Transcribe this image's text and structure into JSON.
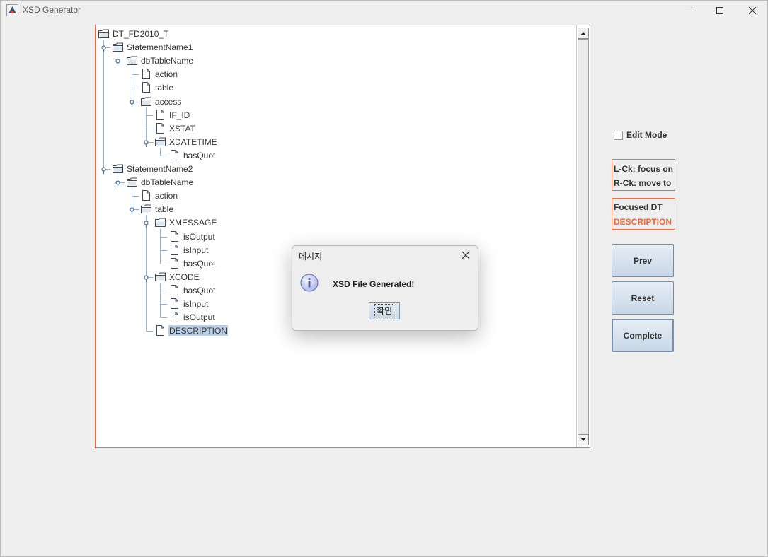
{
  "window": {
    "title": "XSD Generator"
  },
  "tree": [
    {
      "label": "DT_FD2010_T",
      "type": "folder",
      "depth": 0,
      "toggle": false,
      "selected": false
    },
    {
      "label": "StatementName1",
      "type": "folder",
      "depth": 1,
      "toggle": true,
      "selected": false
    },
    {
      "label": "dbTableName",
      "type": "folder",
      "depth": 2,
      "toggle": true,
      "selected": false
    },
    {
      "label": "action",
      "type": "file",
      "depth": 3,
      "toggle": false,
      "selected": false
    },
    {
      "label": "table",
      "type": "file",
      "depth": 3,
      "toggle": false,
      "selected": false
    },
    {
      "label": "access",
      "type": "folder",
      "depth": 3,
      "toggle": true,
      "selected": false
    },
    {
      "label": "IF_ID",
      "type": "file",
      "depth": 4,
      "toggle": false,
      "selected": false
    },
    {
      "label": "XSTAT",
      "type": "file",
      "depth": 4,
      "toggle": false,
      "selected": false
    },
    {
      "label": "XDATETIME",
      "type": "folder",
      "depth": 4,
      "toggle": true,
      "selected": false
    },
    {
      "label": "hasQuot",
      "type": "file",
      "depth": 5,
      "toggle": false,
      "selected": false
    },
    {
      "label": "StatementName2",
      "type": "folder",
      "depth": 1,
      "toggle": true,
      "selected": false
    },
    {
      "label": "dbTableName",
      "type": "folder",
      "depth": 2,
      "toggle": true,
      "selected": false
    },
    {
      "label": "action",
      "type": "file",
      "depth": 3,
      "toggle": false,
      "selected": false
    },
    {
      "label": "table",
      "type": "folder",
      "depth": 3,
      "toggle": true,
      "selected": false
    },
    {
      "label": "XMESSAGE",
      "type": "folder",
      "depth": 4,
      "toggle": true,
      "selected": false
    },
    {
      "label": "isOutput",
      "type": "file",
      "depth": 5,
      "toggle": false,
      "selected": false
    },
    {
      "label": "isInput",
      "type": "file",
      "depth": 5,
      "toggle": false,
      "selected": false
    },
    {
      "label": "hasQuot",
      "type": "file",
      "depth": 5,
      "toggle": false,
      "selected": false
    },
    {
      "label": "XCODE",
      "type": "folder",
      "depth": 4,
      "toggle": true,
      "selected": false
    },
    {
      "label": "hasQuot",
      "type": "file",
      "depth": 5,
      "toggle": false,
      "selected": false
    },
    {
      "label": "isInput",
      "type": "file",
      "depth": 5,
      "toggle": false,
      "selected": false
    },
    {
      "label": "isOutput",
      "type": "file",
      "depth": 5,
      "toggle": false,
      "selected": false
    },
    {
      "label": "DESCRIPTION",
      "type": "file",
      "depth": 4,
      "toggle": false,
      "selected": true
    }
  ],
  "sidebar": {
    "edit_mode_label": "Edit Mode",
    "edit_mode_checked": false,
    "hint_line1": "L-Ck: focus on",
    "hint_line2": "R-Ck: move to",
    "focused_label": "Focused DT",
    "focused_value": "DESCRIPTION",
    "prev_label": "Prev",
    "reset_label": "Reset",
    "complete_label": "Complete"
  },
  "dialog": {
    "title": "메시지",
    "message": "XSD File Generated!",
    "ok_label": "확인",
    "icon": "info-icon"
  },
  "colors": {
    "accent_border": "#ec6c3f",
    "selection": "#b8cfe5",
    "tree_line": "#9fb3c8"
  }
}
